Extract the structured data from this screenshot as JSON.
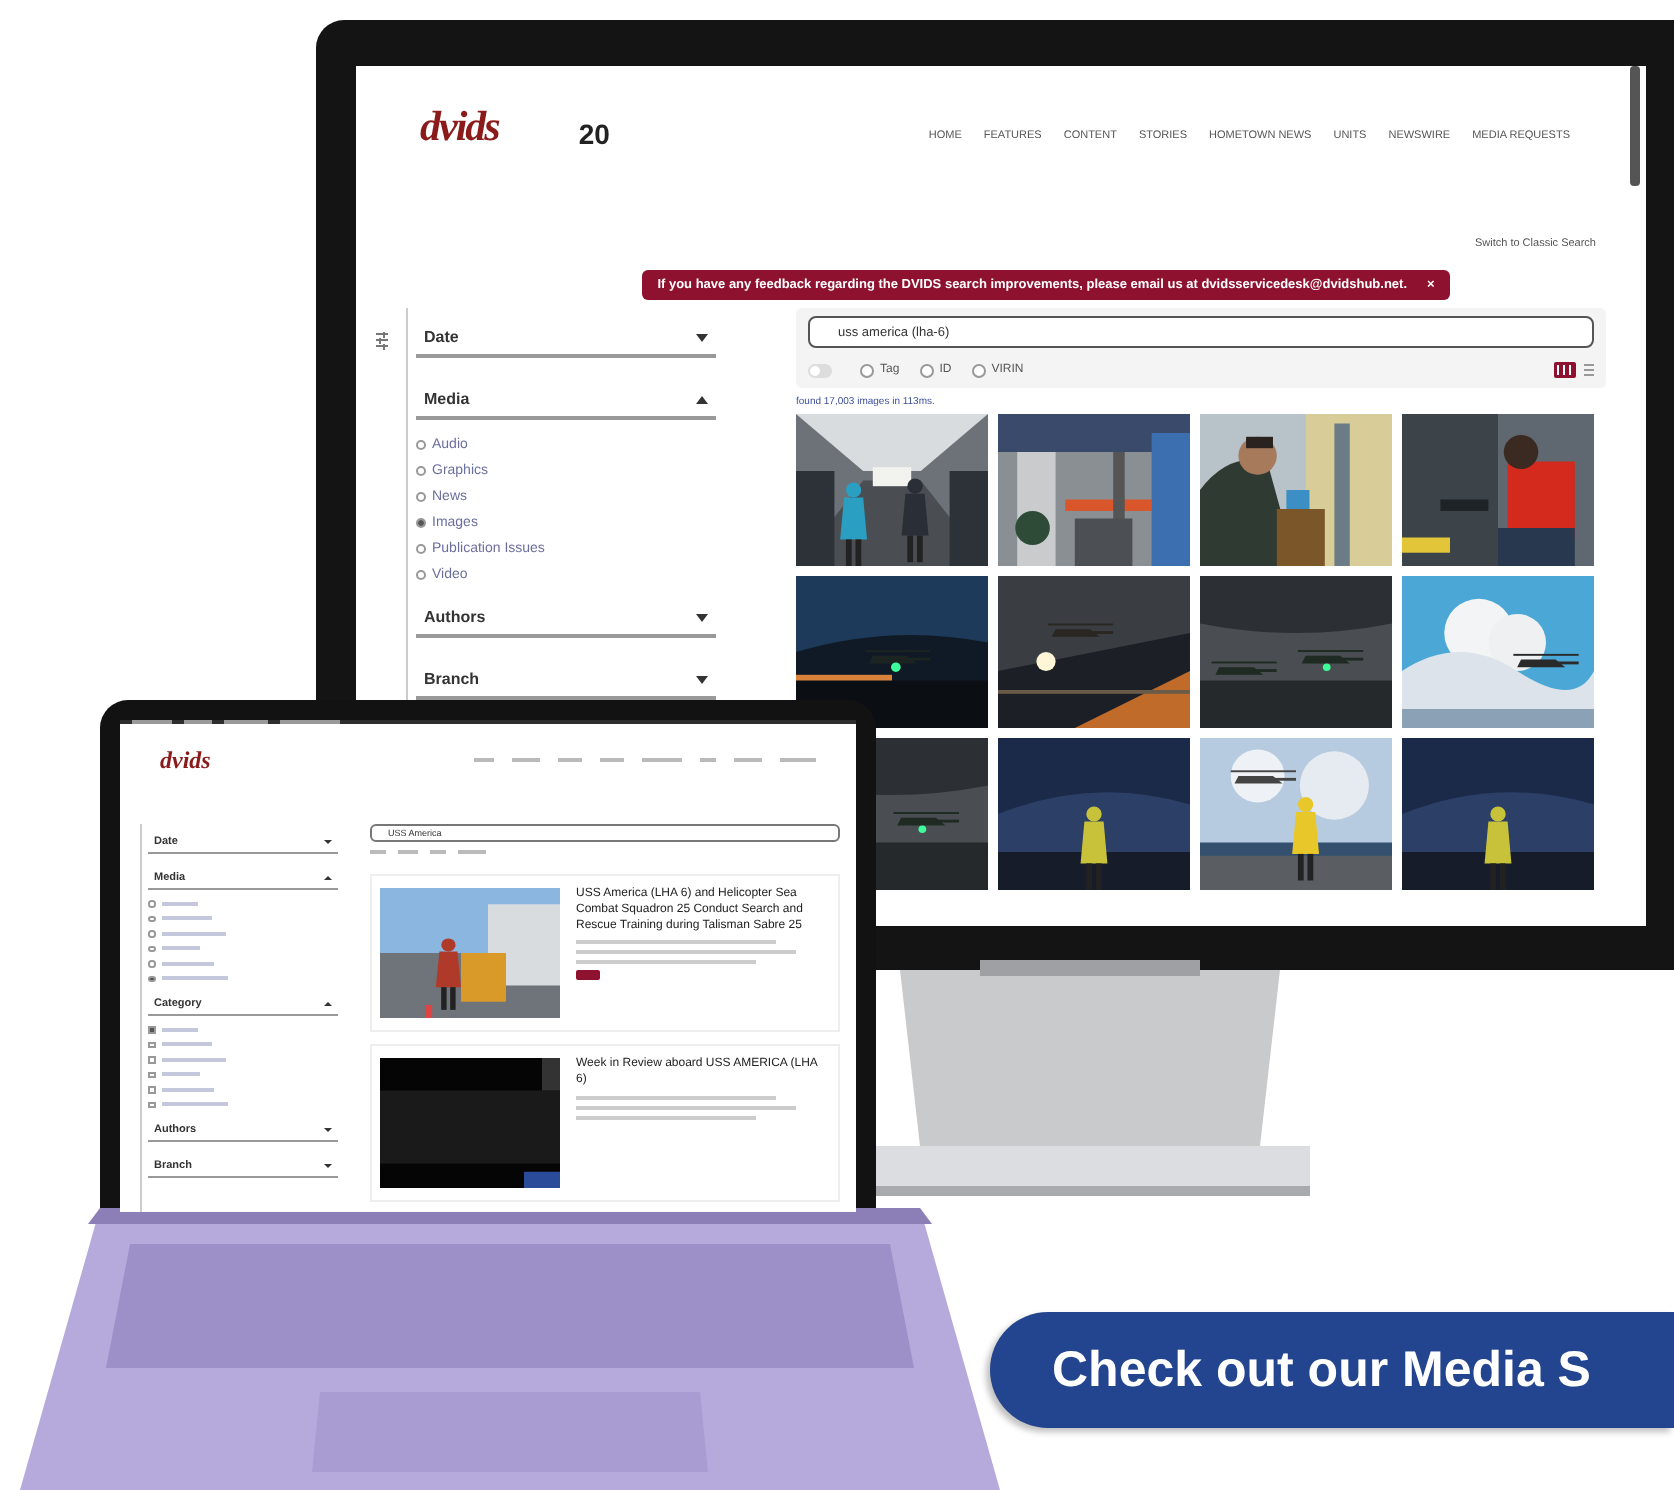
{
  "monitor": {
    "logo": "dvids",
    "badge": "20",
    "nav": [
      "HOME",
      "FEATURES",
      "CONTENT",
      "STORIES",
      "HOMETOWN NEWS",
      "UNITS",
      "NEWSWIRE",
      "MEDIA REQUESTS"
    ],
    "switch_link": "Switch to Classic Search",
    "banner": {
      "text": "If you have any feedback regarding the DVIDS search improvements, please email us at dvidsservicedesk@dvidshub.net.",
      "close": "×"
    },
    "filters": [
      {
        "label": "Date",
        "expanded": false
      },
      {
        "label": "Media",
        "expanded": true,
        "options": [
          {
            "label": "Audio",
            "selected": false
          },
          {
            "label": "Graphics",
            "selected": false
          },
          {
            "label": "News",
            "selected": false
          },
          {
            "label": "Images",
            "selected": true
          },
          {
            "label": "Publication Issues",
            "selected": false
          },
          {
            "label": "Video",
            "selected": false
          }
        ]
      },
      {
        "label": "Authors",
        "expanded": false
      },
      {
        "label": "Branch",
        "expanded": false
      }
    ],
    "search": {
      "value": "uss america (lha-6)",
      "toggle_on": false,
      "modes": [
        {
          "label": "Tag",
          "selected": false
        },
        {
          "label": "ID",
          "selected": false
        },
        {
          "label": "VIRIN",
          "selected": false
        }
      ]
    },
    "result_count": "found 17,003 images in 113ms."
  },
  "laptop": {
    "logo": "dvids",
    "search": {
      "value": "USS America"
    },
    "filters": [
      {
        "label": "Date",
        "expanded": false
      },
      {
        "label": "Media",
        "expanded": true,
        "options": [
          {
            "selected": false
          },
          {
            "selected": false
          },
          {
            "selected": false
          },
          {
            "selected": false
          },
          {
            "selected": false
          },
          {
            "selected": true
          }
        ]
      },
      {
        "label": "Category",
        "expanded": true,
        "options": [
          {
            "checked": true
          },
          {
            "checked": false
          },
          {
            "checked": false
          },
          {
            "checked": false
          },
          {
            "checked": false
          },
          {
            "checked": false
          }
        ]
      },
      {
        "label": "Authors",
        "expanded": false
      },
      {
        "label": "Branch",
        "expanded": false
      }
    ],
    "results": [
      {
        "title": "USS America (LHA 6) and Helicopter Sea Combat Squadron 25 Conduct Search and Rescue Training during Talisman Sabre 25"
      },
      {
        "title": "Week in Review aboard USS AMERICA (LHA 6)"
      }
    ]
  },
  "cta_button": "Check out our Media S"
}
